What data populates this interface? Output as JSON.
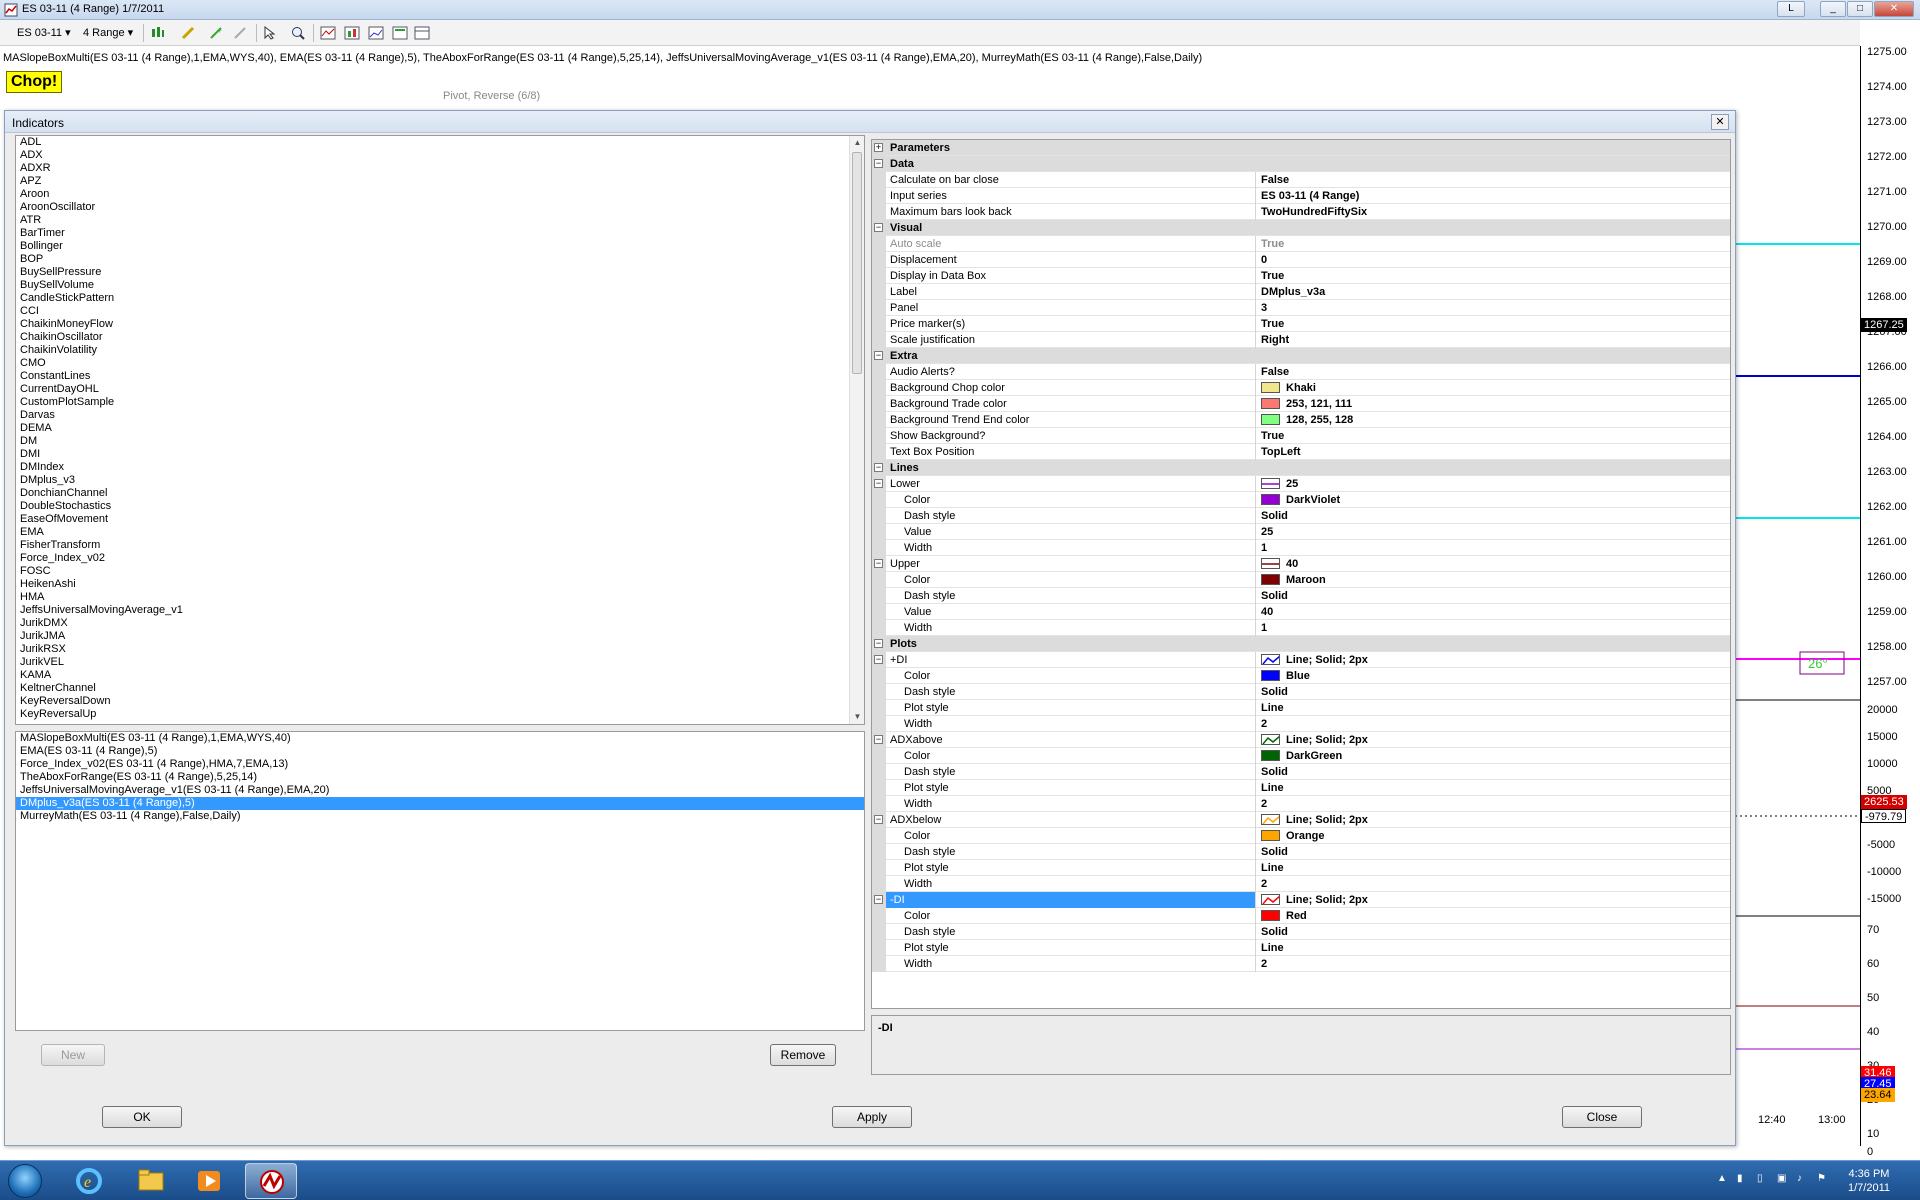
{
  "window": {
    "title": "ES 03-11 (4 Range)  1/7/2011",
    "buttons": [
      "L",
      "_",
      "□",
      "✕"
    ]
  },
  "toolbar": {
    "instrument": "ES 03-11",
    "interval": "4 Range"
  },
  "chart": {
    "indicators_line": "MASlopeBoxMulti(ES 03-11 (4 Range),1,EMA,WYS,40), EMA(ES 03-11 (4 Range),5), TheAboxForRange(ES 03-11 (4 Range),5,25,14), JeffsUniversalMovingAverage_v1(ES 03-11 (4 Range),EMA,20), MurreyMath(ES 03-11 (4 Range),False,Daily)",
    "chop_label": "Chop!",
    "pivot_label": "Pivot, Reverse (6/8)",
    "box_label": "26°",
    "price_ticks": [
      "1275.00",
      "1274.00",
      "1273.00",
      "1272.00",
      "1271.00",
      "1270.00",
      "1269.00",
      "1268.00",
      "1267.00",
      "1266.00",
      "1265.00",
      "1264.00",
      "1263.00",
      "1262.00",
      "1261.00",
      "1260.00",
      "1259.00",
      "1258.00",
      "1257.00"
    ],
    "price_marker": "1267.25",
    "volume_ticks": [
      "20000",
      "15000",
      "10000",
      "5000",
      "0",
      "-5000",
      "-10000",
      "-15000"
    ],
    "volume_markers": [
      "2625.53",
      "-979.79"
    ],
    "osc_ticks": [
      "70",
      "60",
      "50",
      "40",
      "30",
      "20",
      "10",
      "0"
    ],
    "osc_markers": [
      "31.46",
      "27.45",
      "23.64"
    ],
    "time_labels": [
      "12:40",
      "13:00"
    ],
    "colors": {
      "pivot_line": "#ff00ff",
      "cyan_line": "#00e5ee",
      "blue_line": "#0000cc",
      "up_candle": "#90ee90",
      "down_candle": "#ff4d4d"
    }
  },
  "dialog": {
    "title": "Indicators",
    "available_indicators": [
      "ADL",
      "ADX",
      "ADXR",
      "APZ",
      "Aroon",
      "AroonOscillator",
      "ATR",
      "BarTimer",
      "Bollinger",
      "BOP",
      "BuySellPressure",
      "BuySellVolume",
      "CandleStickPattern",
      "CCI",
      "ChaikinMoneyFlow",
      "ChaikinOscillator",
      "ChaikinVolatility",
      "CMO",
      "ConstantLines",
      "CurrentDayOHL",
      "CustomPlotSample",
      "Darvas",
      "DEMA",
      "DM",
      "DMI",
      "DMIndex",
      "DMplus_v3",
      "DonchianChannel",
      "DoubleStochastics",
      "EaseOfMovement",
      "EMA",
      "FisherTransform",
      "Force_Index_v02",
      "FOSC",
      "HeikenAshi",
      "HMA",
      "JeffsUniversalMovingAverage_v1",
      "JurikDMX",
      "JurikJMA",
      "JurikRSX",
      "JurikVEL",
      "KAMA",
      "KeltnerChannel",
      "KeyReversalDown",
      "KeyReversalUp"
    ],
    "applied_indicators": [
      "MASlopeBoxMulti(ES 03-11 (4 Range),1,EMA,WYS,40)",
      "EMA(ES 03-11 (4 Range),5)",
      "Force_Index_v02(ES 03-11 (4 Range),HMA,7,EMA,13)",
      "TheAboxForRange(ES 03-11 (4 Range),5,25,14)",
      "JeffsUniversalMovingAverage_v1(ES 03-11 (4 Range),EMA,20)",
      "DMplus_v3a(ES 03-11 (4 Range),5)",
      "MurreyMath(ES 03-11 (4 Range),False,Daily)"
    ],
    "applied_selected_index": 5,
    "buttons": {
      "new": "New",
      "remove": "Remove",
      "ok": "OK",
      "apply": "Apply",
      "close": "Close"
    },
    "description_title": "-DI",
    "properties": [
      {
        "kind": "cat",
        "name": "Parameters",
        "expander": "+"
      },
      {
        "kind": "cat",
        "name": "Data",
        "expander": "−"
      },
      {
        "kind": "prop",
        "name": "Calculate on bar close",
        "value": "False"
      },
      {
        "kind": "prop",
        "name": "Input series",
        "value": "ES 03-11 (4 Range)"
      },
      {
        "kind": "prop",
        "name": "Maximum bars look back",
        "value": "TwoHundredFiftySix"
      },
      {
        "kind": "cat",
        "name": "Visual",
        "expander": "−"
      },
      {
        "kind": "prop",
        "name": "Auto scale",
        "value": "True",
        "disabled": true
      },
      {
        "kind": "prop",
        "name": "Displacement",
        "value": "0"
      },
      {
        "kind": "prop",
        "name": "Display in Data Box",
        "value": "True"
      },
      {
        "kind": "prop",
        "name": "Label",
        "value": "DMplus_v3a"
      },
      {
        "kind": "prop",
        "name": "Panel",
        "value": "3"
      },
      {
        "kind": "prop",
        "name": "Price marker(s)",
        "value": "True"
      },
      {
        "kind": "prop",
        "name": "Scale justification",
        "value": "Right"
      },
      {
        "kind": "cat",
        "name": "Extra",
        "expander": "−"
      },
      {
        "kind": "prop",
        "name": "Audio Alerts?",
        "value": "False"
      },
      {
        "kind": "prop",
        "name": "Background Chop color",
        "value": "Khaki",
        "swatch": "#f0e68c"
      },
      {
        "kind": "prop",
        "name": "Background Trade color",
        "value": "253, 121, 111",
        "swatch": "#fd796f"
      },
      {
        "kind": "prop",
        "name": "Background Trend End color",
        "value": "128, 255, 128",
        "swatch": "#80ff80"
      },
      {
        "kind": "prop",
        "name": "Show Background?",
        "value": "True"
      },
      {
        "kind": "prop",
        "name": "Text Box Position",
        "value": "TopLeft"
      },
      {
        "kind": "cat",
        "name": "Lines",
        "expander": "−"
      },
      {
        "kind": "sub",
        "name": "Lower",
        "value": "25",
        "swatch": "#9400d3",
        "swatch_line": true
      },
      {
        "kind": "child",
        "name": "Color",
        "value": "DarkViolet",
        "swatch": "#9400d3"
      },
      {
        "kind": "child",
        "name": "Dash style",
        "value": "Solid"
      },
      {
        "kind": "child",
        "name": "Value",
        "value": "25"
      },
      {
        "kind": "child",
        "name": "Width",
        "value": "1"
      },
      {
        "kind": "sub",
        "name": "Upper",
        "value": "40",
        "swatch": "#800000",
        "swatch_line": true
      },
      {
        "kind": "child",
        "name": "Color",
        "value": "Maroon",
        "swatch": "#800000"
      },
      {
        "kind": "child",
        "name": "Dash style",
        "value": "Solid"
      },
      {
        "kind": "child",
        "name": "Value",
        "value": "40"
      },
      {
        "kind": "child",
        "name": "Width",
        "value": "1"
      },
      {
        "kind": "cat",
        "name": "Plots",
        "expander": "−"
      },
      {
        "kind": "sub",
        "name": "+DI",
        "value": "Line; Solid; 2px",
        "swatch": "#0000ff",
        "swatch_zig": true
      },
      {
        "kind": "child",
        "name": "Color",
        "value": "Blue",
        "swatch": "#0000ff"
      },
      {
        "kind": "child",
        "name": "Dash style",
        "value": "Solid"
      },
      {
        "kind": "child",
        "name": "Plot style",
        "value": "Line"
      },
      {
        "kind": "child",
        "name": "Width",
        "value": "2"
      },
      {
        "kind": "sub",
        "name": "ADXabove",
        "value": "Line; Solid; 2px",
        "swatch": "#006400",
        "swatch_zig": true
      },
      {
        "kind": "child",
        "name": "Color",
        "value": "DarkGreen",
        "swatch": "#006400"
      },
      {
        "kind": "child",
        "name": "Dash style",
        "value": "Solid"
      },
      {
        "kind": "child",
        "name": "Plot style",
        "value": "Line"
      },
      {
        "kind": "child",
        "name": "Width",
        "value": "2"
      },
      {
        "kind": "sub",
        "name": "ADXbelow",
        "value": "Line; Solid; 2px",
        "swatch": "#ffa500",
        "swatch_zig": true
      },
      {
        "kind": "child",
        "name": "Color",
        "value": "Orange",
        "swatch": "#ffa500"
      },
      {
        "kind": "child",
        "name": "Dash style",
        "value": "Solid"
      },
      {
        "kind": "child",
        "name": "Plot style",
        "value": "Line"
      },
      {
        "kind": "child",
        "name": "Width",
        "value": "2"
      },
      {
        "kind": "sub",
        "name": "-DI",
        "value": "Line; Solid; 2px",
        "swatch": "#ff0000",
        "swatch_zig": true,
        "selected": true
      },
      {
        "kind": "child",
        "name": "Color",
        "value": "Red",
        "swatch": "#ff0000"
      },
      {
        "kind": "child",
        "name": "Dash style",
        "value": "Solid"
      },
      {
        "kind": "child",
        "name": "Plot style",
        "value": "Line"
      },
      {
        "kind": "child",
        "name": "Width",
        "value": "2"
      }
    ]
  },
  "taskbar": {
    "time": "4:36 PM",
    "date": "1/7/2011"
  }
}
